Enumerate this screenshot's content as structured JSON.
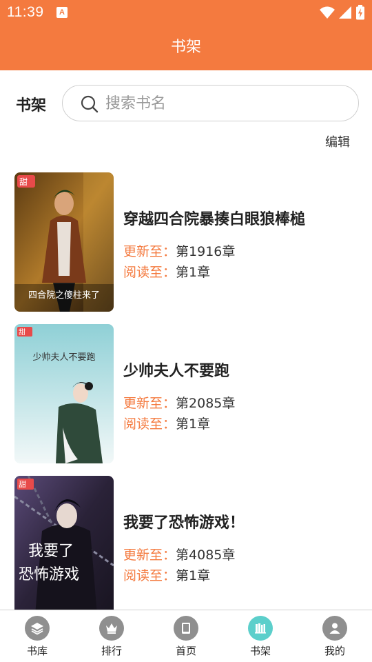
{
  "status_bar": {
    "time": "11:39",
    "notification_letter": "A",
    "icons": [
      "wifi-icon",
      "signal-icon",
      "battery-charging-icon"
    ]
  },
  "header": {
    "title": "书架"
  },
  "search_row": {
    "label": "书架",
    "placeholder": "搜索书名"
  },
  "edit_label": "编辑",
  "books": [
    {
      "title": "穿越四合院暴揍白眼狼棒槌",
      "update_label": "更新至：",
      "update_value": "第1916章",
      "read_label": "阅读至：",
      "read_value": "第1章",
      "cover_text": "四合院之傻柱来了"
    },
    {
      "title": "少帅夫人不要跑",
      "update_label": "更新至：",
      "update_value": "第2085章",
      "read_label": "阅读至：",
      "read_value": "第1章",
      "cover_text": "少帅夫人不要跑"
    },
    {
      "title": "我要了恐怖游戏！",
      "update_label": "更新至：",
      "update_value": "第4085章",
      "read_label": "阅读至：",
      "read_value": "第1章",
      "cover_text_line1": "我要了",
      "cover_text_line2": "恐怖游戏"
    }
  ],
  "tabs": [
    {
      "label": "书库",
      "icon": "layers-icon",
      "active": false
    },
    {
      "label": "排行",
      "icon": "crown-icon",
      "active": false
    },
    {
      "label": "首页",
      "icon": "book-icon",
      "active": false
    },
    {
      "label": "书架",
      "icon": "bookshelf-icon",
      "active": true
    },
    {
      "label": "我的",
      "icon": "user-icon",
      "active": false
    }
  ],
  "colors": {
    "accent": "#F47A3F",
    "active_tab": "#5CCFCB",
    "inactive_tab": "#8F8F8F"
  }
}
